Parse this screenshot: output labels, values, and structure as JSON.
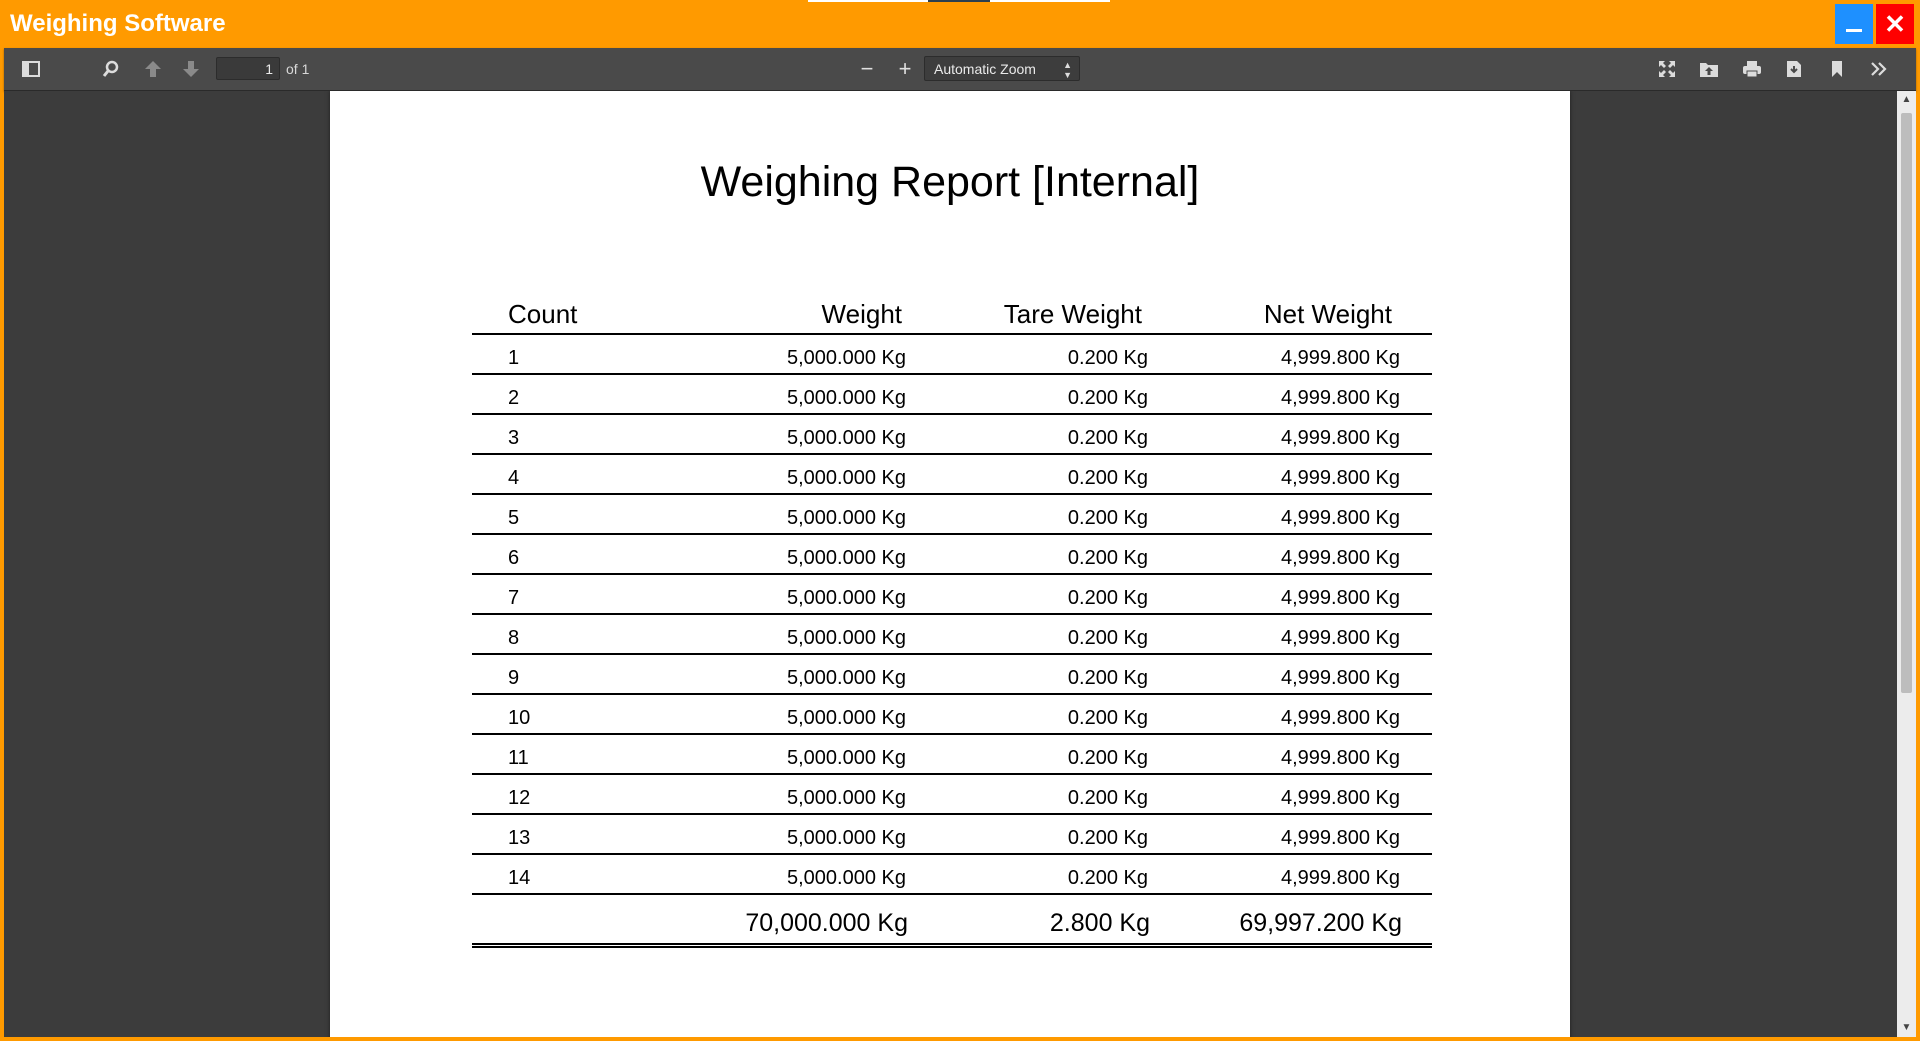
{
  "window": {
    "title": "Weighing Software",
    "minimize_icon": "minimize-icon",
    "close_icon": "close-icon",
    "colors": {
      "titlebar": "#ff9a00",
      "minimize": "#1e90ff",
      "close": "#ff0000"
    }
  },
  "toolbar": {
    "sidebar_toggle_icon": "sidebar-toggle-icon",
    "search_icon": "search-icon",
    "prev_page_icon": "arrow-up-icon",
    "next_page_icon": "arrow-down-icon",
    "page_number": "1",
    "page_count": "of 1",
    "zoom_out": "−",
    "zoom_in": "+",
    "zoom_level": "Automatic Zoom",
    "presentation_icon": "fullscreen-icon",
    "open_file_icon": "open-file-icon",
    "print_icon": "print-icon",
    "download_icon": "download-icon",
    "bookmark_icon": "bookmark-icon",
    "more_tools_icon": "double-chevron-right-icon"
  },
  "report": {
    "title": "Weighing Report [Internal]",
    "headers": {
      "count": "Count",
      "weight": "Weight",
      "tare": "Tare Weight",
      "net": "Net Weight"
    },
    "rows": [
      {
        "count": "1",
        "weight": "5,000.000 Kg",
        "tare": "0.200 Kg",
        "net": "4,999.800 Kg"
      },
      {
        "count": "2",
        "weight": "5,000.000 Kg",
        "tare": "0.200 Kg",
        "net": "4,999.800 Kg"
      },
      {
        "count": "3",
        "weight": "5,000.000 Kg",
        "tare": "0.200 Kg",
        "net": "4,999.800 Kg"
      },
      {
        "count": "4",
        "weight": "5,000.000 Kg",
        "tare": "0.200 Kg",
        "net": "4,999.800 Kg"
      },
      {
        "count": "5",
        "weight": "5,000.000 Kg",
        "tare": "0.200 Kg",
        "net": "4,999.800 Kg"
      },
      {
        "count": "6",
        "weight": "5,000.000 Kg",
        "tare": "0.200 Kg",
        "net": "4,999.800 Kg"
      },
      {
        "count": "7",
        "weight": "5,000.000 Kg",
        "tare": "0.200 Kg",
        "net": "4,999.800 Kg"
      },
      {
        "count": "8",
        "weight": "5,000.000 Kg",
        "tare": "0.200 Kg",
        "net": "4,999.800 Kg"
      },
      {
        "count": "9",
        "weight": "5,000.000 Kg",
        "tare": "0.200 Kg",
        "net": "4,999.800 Kg"
      },
      {
        "count": "10",
        "weight": "5,000.000 Kg",
        "tare": "0.200 Kg",
        "net": "4,999.800 Kg"
      },
      {
        "count": "11",
        "weight": "5,000.000 Kg",
        "tare": "0.200 Kg",
        "net": "4,999.800 Kg"
      },
      {
        "count": "12",
        "weight": "5,000.000 Kg",
        "tare": "0.200 Kg",
        "net": "4,999.800 Kg"
      },
      {
        "count": "13",
        "weight": "5,000.000 Kg",
        "tare": "0.200 Kg",
        "net": "4,999.800 Kg"
      },
      {
        "count": "14",
        "weight": "5,000.000 Kg",
        "tare": "0.200 Kg",
        "net": "4,999.800 Kg"
      }
    ],
    "totals": {
      "weight": "70,000.000 Kg",
      "tare": "2.800 Kg",
      "net": "69,997.200 Kg"
    }
  }
}
